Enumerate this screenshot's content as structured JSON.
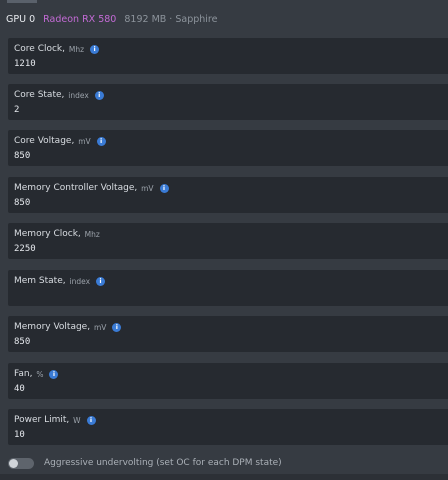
{
  "header": {
    "gpu_id": "GPU 0",
    "model": "Radeon RX 580",
    "memory": "8192 MB · Sapphire"
  },
  "fields": [
    {
      "label": "Core Clock,",
      "unit": "Mhz",
      "value": "1210",
      "info": "i"
    },
    {
      "label": "Core State,",
      "unit": "index",
      "value": "2",
      "info": "i"
    },
    {
      "label": "Core Voltage,",
      "unit": "mV",
      "value": "850",
      "info": "i"
    },
    {
      "label": "Memory Controller Voltage,",
      "unit": "mV",
      "value": "850",
      "info": "i"
    },
    {
      "label": "Memory Clock,",
      "unit": "Mhz",
      "value": "2250",
      "info": ""
    },
    {
      "label": "Mem State,",
      "unit": "index",
      "value": "",
      "info": "i"
    },
    {
      "label": "Memory Voltage,",
      "unit": "mV",
      "value": "850",
      "info": "i"
    },
    {
      "label": "Fan,",
      "unit": "%",
      "value": "40",
      "info": "i"
    },
    {
      "label": "Power Limit,",
      "unit": "W",
      "value": "10",
      "info": "i"
    }
  ],
  "toggle": {
    "label": "Aggressive undervolting (set OC for each DPM state)",
    "on": false
  },
  "colors": {
    "background": "#363b42",
    "field_bg": "#262a30",
    "accent_model": "#c46bd6",
    "info_badge": "#3a7bd5"
  }
}
